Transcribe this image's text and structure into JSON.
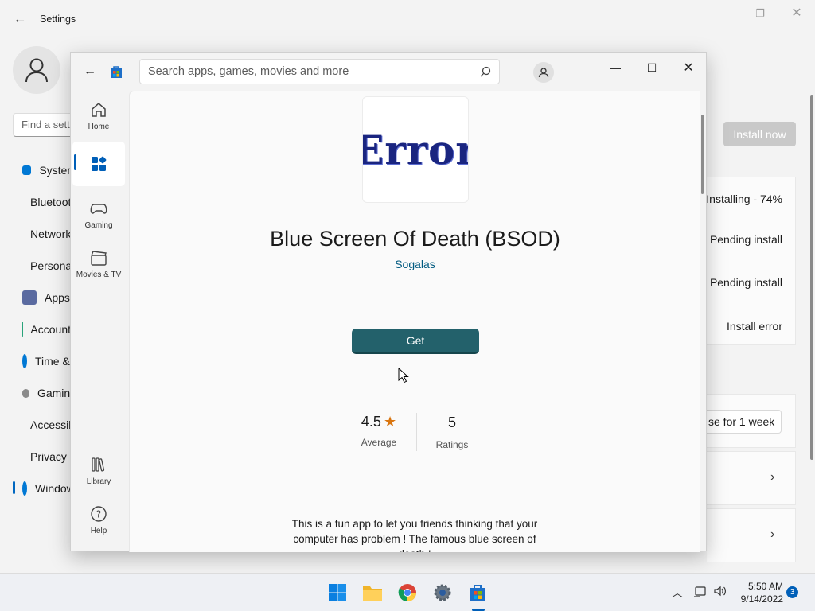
{
  "settings": {
    "title": "Settings",
    "search_placeholder": "Find a setting",
    "nav": [
      {
        "label": "System",
        "icon": "monitor-icon",
        "color": "#0078d4"
      },
      {
        "label": "Bluetooth & devices",
        "icon": "bluetooth-icon",
        "color": "#0078d4"
      },
      {
        "label": "Network & internet",
        "icon": "wifi-icon",
        "color": "#2f8ee0"
      },
      {
        "label": "Personalization",
        "icon": "brush-icon",
        "color": "#e08a2f"
      },
      {
        "label": "Apps",
        "icon": "apps-icon",
        "color": "#5a6aa0"
      },
      {
        "label": "Accounts",
        "icon": "person-icon",
        "color": "#29a37a"
      },
      {
        "label": "Time & language",
        "icon": "clock-globe-icon",
        "color": "#0078d4"
      },
      {
        "label": "Gaming",
        "icon": "controller-icon",
        "color": "#777777"
      },
      {
        "label": "Accessibility",
        "icon": "accessibility-icon",
        "color": "#0078d4"
      },
      {
        "label": "Privacy & security",
        "icon": "shield-icon",
        "color": "#777777"
      },
      {
        "label": "Windows Update",
        "icon": "update-icon",
        "color": "#0078d4"
      }
    ],
    "install_now": "Install now",
    "update_statuses": [
      "Installing - 74%",
      "Pending install",
      "Pending install",
      "Install error"
    ],
    "pause_label": "se for 1 week"
  },
  "store": {
    "search_placeholder": "Search apps, games, movies and more",
    "rail": [
      {
        "label": "Home",
        "icon": "home-icon"
      },
      {
        "label": "",
        "icon": "apps-icon"
      },
      {
        "label": "Gaming",
        "icon": "controller-icon"
      },
      {
        "label": "Movies & TV",
        "icon": "clapperboard-icon"
      },
      {
        "label": "Library",
        "icon": "library-icon"
      },
      {
        "label": "Help",
        "icon": "help-icon"
      }
    ],
    "app": {
      "icon_text": "Error",
      "title": "Blue Screen Of Death (BSOD)",
      "publisher": "Sogalas",
      "get_label": "Get",
      "rating_value": "4.5",
      "rating_label": "Average",
      "ratings_count": "5",
      "ratings_label": "Ratings",
      "description": "This is a fun app to let you friends thinking that your computer has problem ! The famous blue screen of death !"
    }
  },
  "taskbar": {
    "apps": [
      "start-icon",
      "file-explorer-icon",
      "chrome-icon",
      "settings-gear-icon",
      "store-icon"
    ],
    "time": "5:50 AM",
    "date": "9/14/2022",
    "notification_count": "3"
  }
}
